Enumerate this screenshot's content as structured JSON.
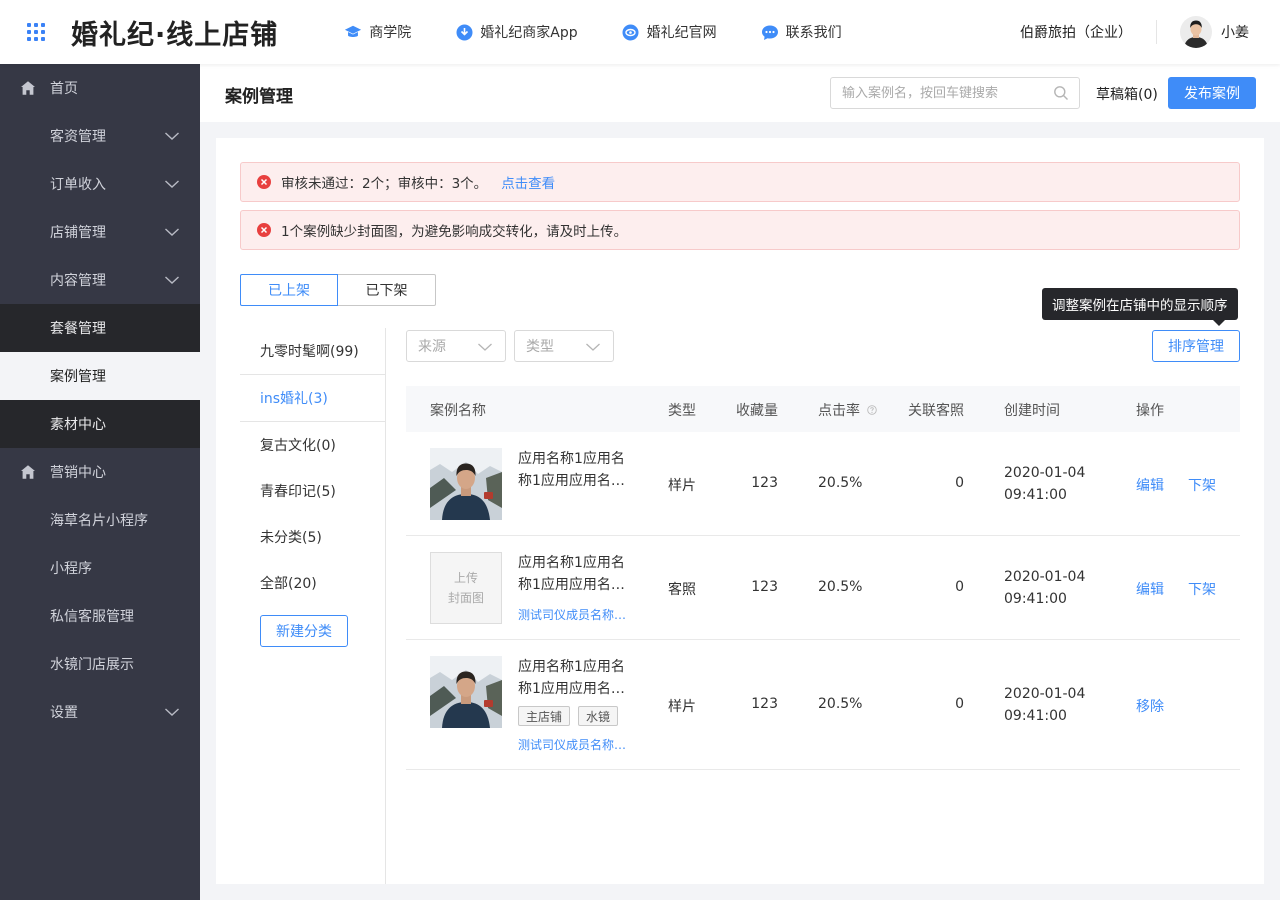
{
  "header": {
    "logo_text": "婚礼纪·线上店铺",
    "nav": [
      {
        "label": "商学院",
        "icon": "graduation-cap-icon"
      },
      {
        "label": "婚礼纪商家App",
        "icon": "download-icon"
      },
      {
        "label": "婚礼纪官网",
        "icon": "globe-icon"
      },
      {
        "label": "联系我们",
        "icon": "chat-icon"
      }
    ],
    "company": "伯爵旅拍（企业）",
    "username": "小姜"
  },
  "sidebar": {
    "items": [
      {
        "label": "首页",
        "icon": "home-icon"
      },
      {
        "label": "客资管理",
        "expandable": true
      },
      {
        "label": "订单收入",
        "expandable": true
      },
      {
        "label": "店铺管理",
        "expandable": true
      },
      {
        "label": "内容管理",
        "expandable": true
      },
      {
        "label": "套餐管理"
      },
      {
        "label": "案例管理",
        "active": true
      },
      {
        "label": "素材中心"
      },
      {
        "label": "营销中心",
        "icon": "store-icon"
      },
      {
        "label": "海草名片小程序"
      },
      {
        "label": "小程序"
      },
      {
        "label": "私信客服管理"
      },
      {
        "label": "水镜门店展示"
      },
      {
        "label": "设置",
        "expandable": true
      }
    ]
  },
  "page": {
    "title": "案例管理",
    "search_placeholder": "输入案例名，按回车键搜索",
    "drafts_label": "草稿箱(0)",
    "publish_label": "发布案例"
  },
  "alerts": [
    {
      "text": "审核未通过：2个；审核中：3个。",
      "link": "点击查看"
    },
    {
      "text": "1个案例缺少封面图，为避免影响成交转化，请及时上传。"
    }
  ],
  "tabs": {
    "listed": "已上架",
    "delisted": "已下架"
  },
  "tooltip": "调整案例在店铺中的显示顺序",
  "sort_button": "排序管理",
  "filters": {
    "source": "来源",
    "type": "类型"
  },
  "categories": [
    "九零时髦啊(99)",
    "ins婚礼(3)",
    "复古文化(0)",
    "青春印记(5)",
    "未分类(5)",
    "全部(20)"
  ],
  "new_category_button": "新建分类",
  "table": {
    "columns": {
      "name": "案例名称",
      "type": "类型",
      "favorites": "收藏量",
      "ctr": "点击率",
      "linked": "关联客照",
      "created": "创建时间",
      "actions": "操作"
    },
    "rows": [
      {
        "name": "应用名称1应用名称1应用应用名…",
        "type": "样片",
        "favorites": "123",
        "ctr": "20.5%",
        "linked": "0",
        "date": "2020-01-04",
        "time": "09:41:00",
        "actions": [
          "编辑",
          "下架"
        ]
      },
      {
        "name": "应用名称1应用名称1应用应用名…",
        "cover_placeholder": [
          "上传",
          "封面图"
        ],
        "sub_link": "测试司仪成员名称…",
        "type": "客照",
        "favorites": "123",
        "ctr": "20.5%",
        "linked": "0",
        "date": "2020-01-04",
        "time": "09:41:00",
        "actions": [
          "编辑",
          "下架"
        ]
      },
      {
        "name": "应用名称1应用名称1应用应用名…",
        "tags": [
          "主店铺",
          "水镜"
        ],
        "sub_link": "测试司仪成员名称…",
        "type": "样片",
        "favorites": "123",
        "ctr": "20.5%",
        "linked": "0",
        "date": "2020-01-04",
        "time": "09:41:00",
        "actions": [
          "移除"
        ]
      }
    ]
  },
  "colors": {
    "accent": "#3f8cf8",
    "sidebar_bg": "#363845",
    "alert_bg": "#fdeeee",
    "error_icon": "#e8403f"
  }
}
